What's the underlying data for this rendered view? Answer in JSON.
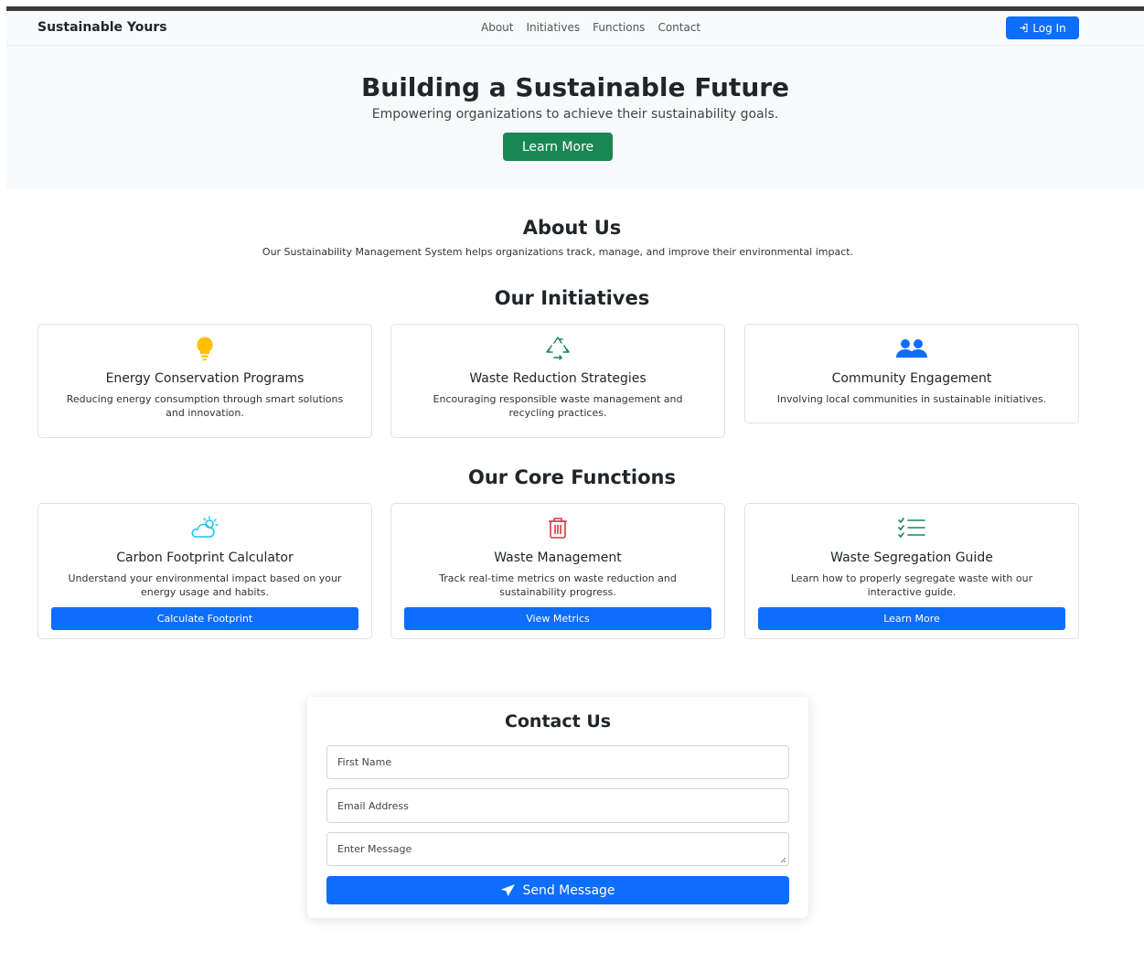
{
  "navbar": {
    "brand": "Sustainable Yours",
    "links": [
      "About",
      "Initiatives",
      "Functions",
      "Contact"
    ],
    "login_label": "Log In",
    "login_icon": "login-icon"
  },
  "hero": {
    "title": "Building a Sustainable Future",
    "subtitle": "Empowering organizations to achieve their sustainability goals.",
    "button_label": "Learn More"
  },
  "about": {
    "title": "About Us",
    "text": "Our Sustainability Management System helps organizations track, manage, and improve their environmental impact."
  },
  "initiatives": {
    "title": "Our Initiatives",
    "items": [
      {
        "icon": "lightbulb-icon",
        "title": "Energy Conservation Programs",
        "text": "Reducing energy consumption through smart solutions and innovation."
      },
      {
        "icon": "recycle-icon",
        "title": "Waste Reduction Strategies",
        "text": "Encouraging responsible waste management and recycling practices."
      },
      {
        "icon": "people-icon",
        "title": "Community Engagement",
        "text": "Involving local communities in sustainable initiatives."
      }
    ]
  },
  "functions": {
    "title": "Our Core Functions",
    "items": [
      {
        "icon": "cloud-sun-icon",
        "title": "Carbon Footprint Calculator",
        "text": "Understand your environmental impact based on your energy usage and habits.",
        "button": "Calculate Footprint"
      },
      {
        "icon": "trash-icon",
        "title": "Waste Management",
        "text": "Track real-time metrics on waste reduction and sustainability progress.",
        "button": "View Metrics"
      },
      {
        "icon": "list-check-icon",
        "title": "Waste Segregation Guide",
        "text": "Learn how to properly segregate waste with our interactive guide.",
        "button": "Learn More"
      }
    ]
  },
  "contact": {
    "title": "Contact Us",
    "first_name_placeholder": "First Name",
    "email_placeholder": "Email Address",
    "message_placeholder": "Enter Message",
    "send_label": "Send Message",
    "send_icon": "send-icon"
  },
  "colors": {
    "primary": "#0d6efd",
    "success": "#198754",
    "warning": "#ffc107",
    "danger": "#dc3545",
    "light": "#f8f9fa"
  }
}
